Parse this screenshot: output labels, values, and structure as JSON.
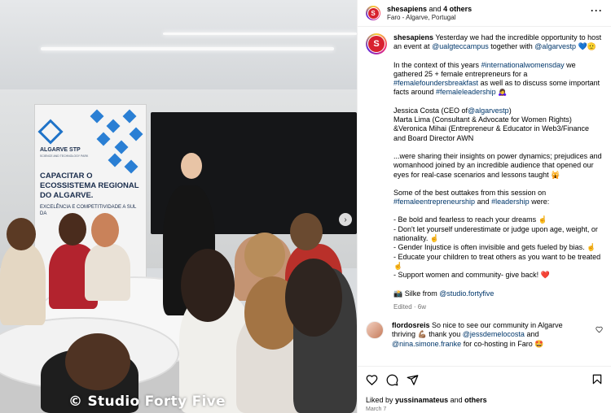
{
  "header": {
    "username": "shesapiens",
    "and_text": "and",
    "others": "4 others",
    "location": "Faro - Algarve, Portugal",
    "more_icon": "more-horizontal-icon"
  },
  "photo": {
    "banner_brand": "ALGARVE STP",
    "banner_brand_sub": "SCIENCE AND TECHNOLOGY PARK",
    "banner_headline": "CAPACITAR O ECOSSISTEMA REGIONAL DO ALGARVE.",
    "banner_subline": "EXCELÊNCIA E COMPETITIVIDADE A SUL DA",
    "watermark": "© Studio Forty Five",
    "next_icon": "chevron-right-icon"
  },
  "caption": {
    "username": "shesapiens",
    "p1_text": "Yesterday we had the incredible opportunity to host an event at",
    "p1_tag1": "@ualgteccampus",
    "p1_mid": "together with",
    "p1_tag2": "@algarvestp",
    "p1_emoji": "💙🫡",
    "p2_a": "In the context of this years",
    "p2_tag1": "#internationalwomensday",
    "p2_b": "we gathered 25 + female entrepreneurs for a",
    "p2_tag2": "#femalefoundersbreakfast",
    "p2_c": "as well as to discuss some important facts around",
    "p2_tag3": "#femaleleadership",
    "p2_emoji": "🙇‍♀️",
    "p3_a": "Jessica Costa (CEO of",
    "p3_tag": "@algarvestp",
    "p3_b": ")",
    "p3_line2": "Marta Lima (Consultant & Advocate for Women Rights)",
    "p3_line3": "&Veronica Mihai (Entrepreneur & Educator in Web3/Finance and Board Director AWN",
    "p4": "...were sharing their insights on power dynamics; prejudices and womanhood joined by an incredible audience that opened our eyes for real-case scenarios and lessons taught 🙀",
    "p5_a": "Some of the best outtakes from this session on",
    "p5_tag1": "#femaleentrepreneurship",
    "p5_b": "and",
    "p5_tag2": "#leadership",
    "p5_c": "were:",
    "list": [
      "- Be bold and fearless to reach your dreams ☝️",
      "- Don't let yourself underestimate or judge upon age, weight, or nationality. ☝️",
      "- Gender Injustice is often invisible and gets fueled by bias. ☝️",
      "- Educate your children to treat others as you want to be treated ☝️",
      "- Support women and community- give back! ❤️"
    ],
    "credit_a": "📸 Silke from",
    "credit_tag": "@studio.fortyfive",
    "edited": "Edited",
    "time": "6w"
  },
  "comment": {
    "username": "flordosreis",
    "text_a": "So nice to see our community in Algarve thriving 💪🏽 thank you",
    "tag1": "@jessdemelocosta",
    "text_b": "and",
    "tag2": "@nina.simone.franke",
    "text_c": "for co-hosting in Faro 🤩",
    "like_icon": "heart-outline-icon"
  },
  "actions": {
    "like_icon": "heart-icon",
    "comment_icon": "comment-icon",
    "share_icon": "send-icon",
    "save_icon": "bookmark-icon",
    "liked_by_label": "Liked by",
    "liked_by_user": "yussinamateus",
    "and_label": "and",
    "others_label": "others",
    "date": "March 7"
  }
}
